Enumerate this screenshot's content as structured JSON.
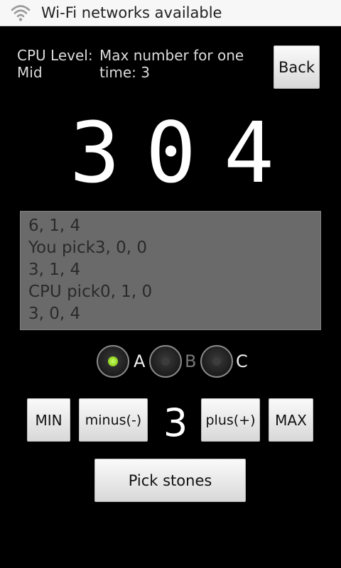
{
  "status_bar": {
    "icon": "wifi-icon",
    "text": "Wi-Fi networks available"
  },
  "header": {
    "cpu_level_label": "CPU Level:",
    "cpu_level_value": "Mid",
    "max_label": "Max number for one time: 3",
    "back_label": "Back"
  },
  "piles": [
    "3",
    "0",
    "4"
  ],
  "log": {
    "lines": [
      "6, 1, 4",
      "You pick3, 0, 0",
      "3, 1, 4",
      "CPU pick0, 1, 0",
      "3, 0, 4"
    ]
  },
  "radios": {
    "options": [
      "A",
      "B",
      "C"
    ],
    "selected": "A",
    "disabled": "B",
    "checked_color": "#8fd11e"
  },
  "controls": {
    "min_label": "MIN",
    "minus_label": "minus(-)",
    "count": "3",
    "plus_label": "plus(+)",
    "max_label": "MAX",
    "pick_label": "Pick stones"
  }
}
